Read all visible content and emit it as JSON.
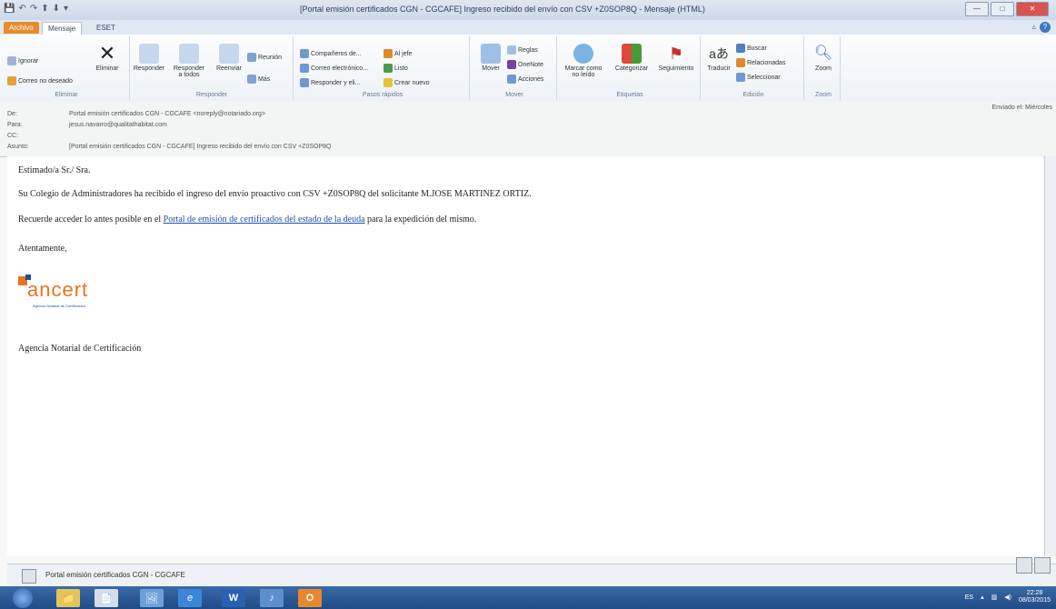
{
  "window": {
    "title": "[Portal emisión certificados CGN - CGCAFE] Ingreso recibido del envío con CSV +Z0SOP8Q - Mensaje (HTML)",
    "quick_access": [
      "💾",
      "↶",
      "↷",
      "⬆",
      "⬇",
      "▾"
    ]
  },
  "tabs": {
    "file": "Archivo",
    "message": "Mensaje",
    "eset": "ESET"
  },
  "ribbon": {
    "groups": {
      "delete": "Eliminar",
      "respond": "Responder",
      "quick_steps": "Pasos rápidos",
      "move": "Mover",
      "tags": "Etiquetas",
      "editing": "Edición",
      "zoom": "Zoom"
    },
    "buttons": {
      "ignore": "Ignorar",
      "junk": "Correo no deseado",
      "delete": "Eliminar",
      "reply": "Responder",
      "reply_all": "Responder a todos",
      "forward": "Reenviar",
      "meeting": "Reunión",
      "more": "Más",
      "qs_coworkers": "Compañeros de...",
      "qs_manager": "Al jefe",
      "qs_email": "Correo electrónico...",
      "qs_done": "Listo",
      "qs_reply_delete": "Responder y eli...",
      "qs_new": "Crear nuevo",
      "move": "Mover",
      "rules": "Reglas",
      "onenote": "OneNote",
      "actions": "Acciones",
      "mark_unread": "Marcar como no leído",
      "categorize": "Categorizar",
      "followup": "Seguimiento",
      "translate": "Traducir",
      "find": "Buscar",
      "related": "Relacionadas",
      "select": "Seleccionar",
      "zoom": "Zoom"
    }
  },
  "headers": {
    "from_label": "De:",
    "from_value": "Portal emisión certificados CGN - CGCAFE <noreply@notariado.org>",
    "to_label": "Para:",
    "to_value": "jesus.navarro@qualitathabitat.com",
    "cc_label": "CC:",
    "cc_value": "",
    "subject_label": "Asunto:",
    "subject_value": "[Portal emisión certificados CGN - CGCAFE] Ingreso recibido del envío con CSV +Z0SOP8Q",
    "sent_label": "Enviado el: Miércoles"
  },
  "body": {
    "greeting": "Estimado/a Sr./ Sra.",
    "line1": "Su Colegio de Administradores ha recibido el ingreso del envío proactivo con CSV +Z0SOP8Q del solicitante M.JOSE MARTINEZ ORTIZ.",
    "line2_before": "Recuerde acceder lo antes posible en el",
    "line2_link": "Portal de emisión de certificados del estado de la deuda",
    "line2_after": "para la expedición del mismo.",
    "closing": "Atentamente,",
    "logo_text": "ancert",
    "logo_sub": "Agencia Notarial de Certificación",
    "signature": "Agencia Notarial de Certificación"
  },
  "people_pane": {
    "name": "Portal emisión certificados CGN - CGCAFE"
  },
  "taskbar": {
    "apps": [
      "📁",
      "📄",
      "🖼",
      "e",
      "W",
      "♪",
      "O"
    ],
    "tray_lang": "ES",
    "time": "22:28",
    "date": "08/03/2015"
  },
  "colors": {
    "accent": "#e9731e",
    "link": "#1a4ea8",
    "taskbar": "#2c5fa8"
  }
}
